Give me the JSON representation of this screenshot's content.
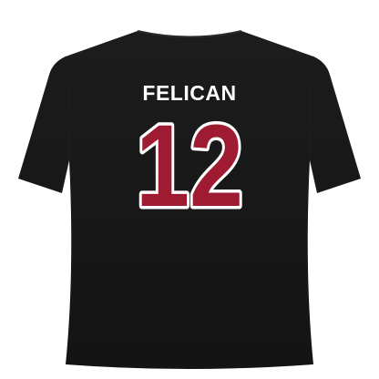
{
  "product": {
    "player_name": "FELICAN",
    "jersey_number": "12",
    "shirt_color": "#141414",
    "number_fill_color": "#9e1b32",
    "number_outline_color": "#ffffff",
    "name_color": "#ffffff",
    "background_color": "#ffffff"
  }
}
